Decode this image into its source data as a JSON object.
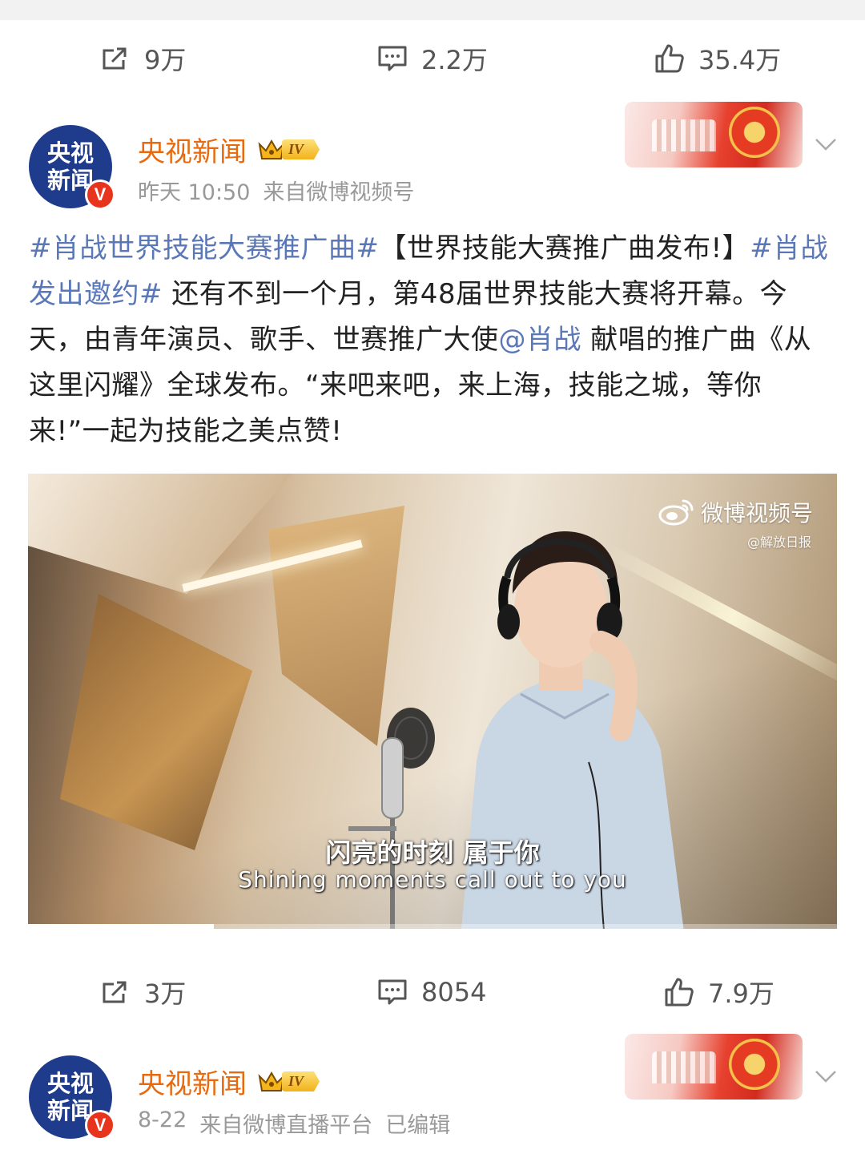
{
  "top_actions": {
    "repost": "9万",
    "comment": "2.2万",
    "like": "35.4万"
  },
  "post1": {
    "author": "央视新闻",
    "avatar_line1": "央视",
    "avatar_line2": "新闻",
    "avatar_badge": "V",
    "level": "IV",
    "time": "昨天 10:50",
    "source": "来自微博视频号",
    "text": {
      "tag1": "#肖战世界技能大赛推广曲#",
      "bracket": "【世界技能大赛推广曲发布!】",
      "tag2": "#肖战发出邀约#",
      "body1": " 还有不到一个月，第48届世界技能大赛将开幕。今天，由青年演员、歌手、世赛推广大使",
      "mention": "@肖战",
      "body2": " 献唱的推广曲《从这里闪耀》全球发布。“来吧来吧，来上海，技能之城，等你来!”一起为技能之美点赞!"
    },
    "video": {
      "watermark": "微博视频号",
      "watermark_sub": "@解放日报",
      "subtitle_cn": "闪亮的时刻 属于你",
      "subtitle_en": "Shining moments call out to you",
      "progress": 0.23
    },
    "actions": {
      "repost": "3万",
      "comment": "8054",
      "like": "7.9万"
    }
  },
  "post2": {
    "author": "央视新闻",
    "avatar_line1": "央视",
    "avatar_line2": "新闻",
    "avatar_badge": "V",
    "level": "IV",
    "time": "8-22",
    "source": "来自微博直播平台",
    "edited": "已编辑"
  },
  "colors": {
    "author": "#e86a10",
    "link": "#5a78b8",
    "badge_red": "#e8341c"
  },
  "icons": [
    "repost-icon",
    "comment-icon",
    "like-icon",
    "crown-icon",
    "chevron-down-icon",
    "weibo-logo-icon"
  ]
}
